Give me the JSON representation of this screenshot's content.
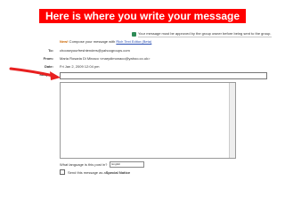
{
  "slide": {
    "caption": "Here is where you write your message"
  },
  "notice": {
    "text": "Your message must be approved by the group owner before being sent to the group."
  },
  "compose": {
    "new_badge": "New!",
    "compose_text": " Compose your message with ",
    "rich_text_link": "Rich Text Editor (Beta)"
  },
  "fields": {
    "to_label": "To:",
    "to_value": "chooseyourfreshtenders@yahoogroups.com",
    "from_label": "From:",
    "from_value": "Maria Rosaria Di Minaco <marydimonaco@yahoo.co.uk>",
    "date_label": "Date:",
    "date_value": "Fri Jan 2, 2009 12:04 pm",
    "subject_label": "Subject:",
    "subject_value": ""
  },
  "language": {
    "label": "What language is this post in?",
    "selected": "English"
  },
  "special_notice": {
    "prefix": "Send this message as a ",
    "emphasis": "Special Notice"
  },
  "colors": {
    "caption_bg": "#ff0000",
    "caption_text": "#ffffff",
    "arrow": "#e82020",
    "link": "#2b4fb3",
    "new_badge": "#cc6600"
  }
}
